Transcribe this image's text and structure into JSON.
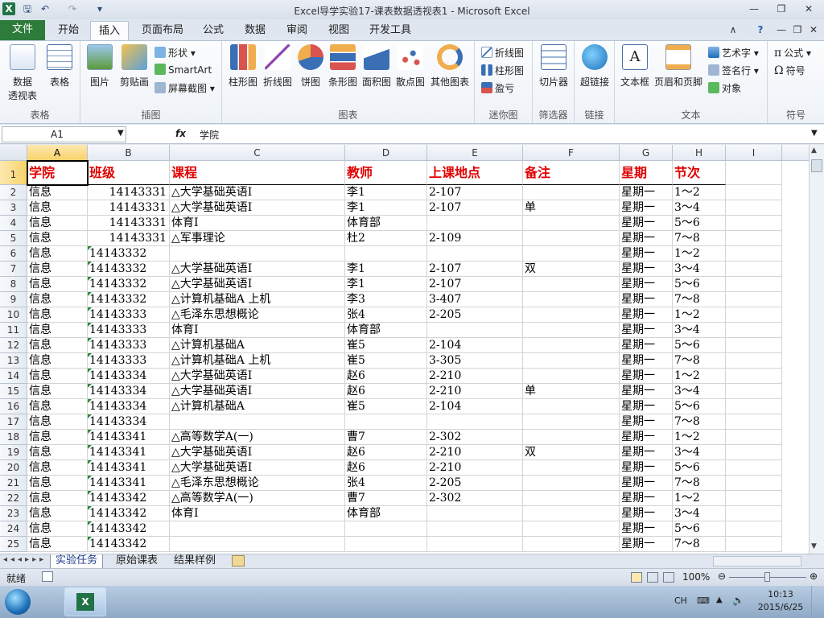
{
  "window": {
    "title": "Excel导学实验17-课表数据透视表1 - Microsoft Excel",
    "app_icon": "excel-icon",
    "controls": [
      "minimize-icon",
      "restore-icon",
      "close-icon"
    ]
  },
  "quick_access": [
    "save-icon",
    "undo-icon",
    "redo-icon",
    "customize-icon"
  ],
  "ribbon_tabs": [
    {
      "label": "文件"
    },
    {
      "label": "开始"
    },
    {
      "label": "插入"
    },
    {
      "label": "页面布局"
    },
    {
      "label": "公式"
    },
    {
      "label": "数据"
    },
    {
      "label": "审阅"
    },
    {
      "label": "视图"
    },
    {
      "label": "开发工具"
    }
  ],
  "active_tab": "插入",
  "ribbon": {
    "groups": [
      {
        "label": "表格",
        "buttons": [
          "数据",
          "透视表",
          "表格"
        ]
      },
      {
        "label": "插图",
        "buttons": [
          "图片",
          "剪贴画",
          "形状",
          "SmartArt",
          "屏幕截图"
        ]
      },
      {
        "label": "图表",
        "buttons": [
          "柱形图",
          "折线图",
          "饼图",
          "条形图",
          "面积图",
          "散点图",
          "其他图表"
        ]
      },
      {
        "label": "迷你图",
        "buttons": [
          "折线图",
          "柱形图",
          "盈亏"
        ]
      },
      {
        "label": "筛选器",
        "buttons": [
          "切片器"
        ]
      },
      {
        "label": "链接",
        "buttons": [
          "超链接"
        ]
      },
      {
        "label": "文本",
        "buttons": [
          "文本框",
          "页眉和页脚",
          "艺术字",
          "签名行",
          "对象"
        ]
      },
      {
        "label": "符号",
        "buttons": [
          "公式",
          "符号"
        ]
      }
    ]
  },
  "formula_bar": {
    "name_box": "A1",
    "fx": "fx",
    "formula": "学院"
  },
  "columns": [
    "A",
    "B",
    "C",
    "D",
    "E",
    "F",
    "G",
    "H",
    "I"
  ],
  "header_row": {
    "row": "1",
    "cells": [
      "学院",
      "班级",
      "课程",
      "教师",
      "上课地点",
      "备注",
      "星期",
      "节次"
    ]
  },
  "rows": [
    {
      "row": "2",
      "cells": [
        "信息",
        "14143331",
        "△大学基础英语Ⅰ",
        "李1",
        "2-107",
        "",
        "星期一",
        "1～2"
      ]
    },
    {
      "row": "3",
      "cells": [
        "信息",
        "14143331",
        "△大学基础英语Ⅰ",
        "李1",
        "2-107",
        "单",
        "星期一",
        "3～4"
      ]
    },
    {
      "row": "4",
      "cells": [
        "信息",
        "14143331",
        "体育Ⅰ",
        "体育部",
        "",
        "",
        "星期一",
        "5～6"
      ]
    },
    {
      "row": "5",
      "cells": [
        "信息",
        "14143331",
        "△军事理论",
        "杜2",
        "2-109",
        "",
        "星期一",
        "7～8"
      ]
    },
    {
      "row": "6",
      "cells": [
        "信息",
        "14143332",
        "",
        "",
        "",
        "",
        "星期一",
        "1～2"
      ]
    },
    {
      "row": "7",
      "cells": [
        "信息",
        "14143332",
        "△大学基础英语Ⅰ",
        "李1",
        "2-107",
        "双",
        "星期一",
        "3～4"
      ]
    },
    {
      "row": "8",
      "cells": [
        "信息",
        "14143332",
        "△大学基础英语Ⅰ",
        "李1",
        "2-107",
        "",
        "星期一",
        "5～6"
      ]
    },
    {
      "row": "9",
      "cells": [
        "信息",
        "14143332",
        "△计算机基础A 上机",
        "李3",
        "3-407",
        "",
        "星期一",
        "7～8"
      ]
    },
    {
      "row": "10",
      "cells": [
        "信息",
        "14143333",
        "△毛泽东思想概论",
        "张4",
        "2-205",
        "",
        "星期一",
        "1～2"
      ]
    },
    {
      "row": "11",
      "cells": [
        "信息",
        "14143333",
        "体育Ⅰ",
        "体育部",
        "",
        "",
        "星期一",
        "3～4"
      ]
    },
    {
      "row": "12",
      "cells": [
        "信息",
        "14143333",
        "△计算机基础A",
        "崔5",
        "2-104",
        "",
        "星期一",
        "5～6"
      ]
    },
    {
      "row": "13",
      "cells": [
        "信息",
        "14143333",
        "△计算机基础A 上机",
        "崔5",
        "3-305",
        "",
        "星期一",
        "7～8"
      ]
    },
    {
      "row": "14",
      "cells": [
        "信息",
        "14143334",
        "△大学基础英语Ⅰ",
        "赵6",
        "2-210",
        "",
        "星期一",
        "1～2"
      ]
    },
    {
      "row": "15",
      "cells": [
        "信息",
        "14143334",
        "△大学基础英语Ⅰ",
        "赵6",
        "2-210",
        "单",
        "星期一",
        "3～4"
      ]
    },
    {
      "row": "16",
      "cells": [
        "信息",
        "14143334",
        "△计算机基础A",
        "崔5",
        "2-104",
        "",
        "星期一",
        "5～6"
      ]
    },
    {
      "row": "17",
      "cells": [
        "信息",
        "14143334",
        "",
        "",
        "",
        "",
        "星期一",
        "7～8"
      ]
    },
    {
      "row": "18",
      "cells": [
        "信息",
        "14143341",
        "△高等数学A(一)",
        "曹7",
        "2-302",
        "",
        "星期一",
        "1～2"
      ]
    },
    {
      "row": "19",
      "cells": [
        "信息",
        "14143341",
        "△大学基础英语Ⅰ",
        "赵6",
        "2-210",
        "双",
        "星期一",
        "3～4"
      ]
    },
    {
      "row": "20",
      "cells": [
        "信息",
        "14143341",
        "△大学基础英语Ⅰ",
        "赵6",
        "2-210",
        "",
        "星期一",
        "5～6"
      ]
    },
    {
      "row": "21",
      "cells": [
        "信息",
        "14143341",
        "△毛泽东思想概论",
        "张4",
        "2-205",
        "",
        "星期一",
        "7～8"
      ]
    },
    {
      "row": "22",
      "cells": [
        "信息",
        "14143342",
        "△高等数学A(一)",
        "曹7",
        "2-302",
        "",
        "星期一",
        "1～2"
      ]
    },
    {
      "row": "23",
      "cells": [
        "信息",
        "14143342",
        "体育Ⅰ",
        "体育部",
        "",
        "",
        "星期一",
        "3～4"
      ]
    },
    {
      "row": "24",
      "cells": [
        "信息",
        "14143342",
        "",
        "",
        "",
        "",
        "星期一",
        "5～6"
      ]
    },
    {
      "row": "25",
      "cells": [
        "信息",
        "14143342",
        "",
        "",
        "",
        "",
        "星期一",
        "7～8"
      ]
    }
  ],
  "number_cells_right_aligned_rows": [
    "2",
    "3",
    "4",
    "5"
  ],
  "sheets": [
    {
      "label": "实验任务",
      "active": true
    },
    {
      "label": "原始课表"
    },
    {
      "label": "结果样例"
    }
  ],
  "status": {
    "ready": "就绪",
    "zoom": "100%"
  },
  "taskbar": {
    "lang": "CH",
    "time": "10:13",
    "date": "2015/6/25"
  },
  "colors": {
    "header_text": "#e00000",
    "file_tab": "#2d7c3b",
    "selection": "#f8d26a"
  }
}
